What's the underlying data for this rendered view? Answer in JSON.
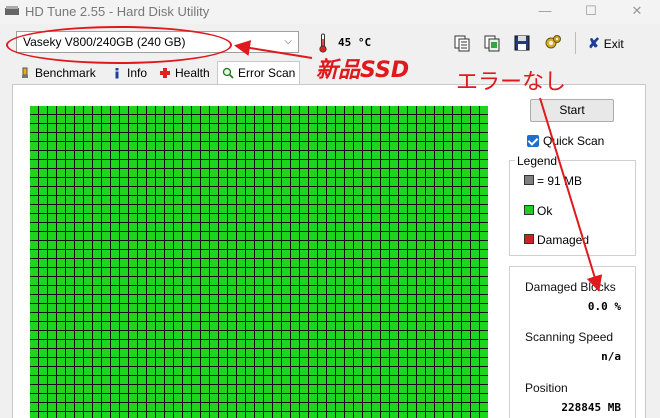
{
  "window": {
    "title": "HD Tune 2.55 - Hard Disk Utility",
    "min_glyph": "—",
    "max_glyph": "☐",
    "close_glyph": "✕"
  },
  "toolbar": {
    "drive": "Vaseky  V800/240GB (240 GB)",
    "temperature": "45 °C",
    "exit_label": "Exit"
  },
  "tabs": [
    {
      "label": "Benchmark",
      "icon": "benchmark-icon"
    },
    {
      "label": "Info",
      "icon": "info-icon"
    },
    {
      "label": "Health",
      "icon": "health-icon"
    },
    {
      "label": "Error Scan",
      "icon": "error-scan-icon",
      "active": true
    }
  ],
  "scan": {
    "start_label": "Start",
    "quick_scan_label": "Quick Scan",
    "quick_scan_checked": true,
    "block_status": "all ok"
  },
  "legend": {
    "title": "Legend",
    "items": [
      {
        "label": "= 91 MB",
        "color": "#808080"
      },
      {
        "label": "Ok",
        "color": "#22cc22"
      },
      {
        "label": "Damaged",
        "color": "#cc2222"
      }
    ]
  },
  "stats": {
    "damaged_blocks_label": "Damaged Blocks",
    "damaged_blocks_value": "0.0 %",
    "scanning_speed_label": "Scanning Speed",
    "scanning_speed_value": "n/a",
    "position_label": "Position",
    "position_value": "228845 MB"
  },
  "annotations": {
    "new_ssd": "新品SSD",
    "no_errors": "エラーなし",
    "color": "#e0191c"
  }
}
